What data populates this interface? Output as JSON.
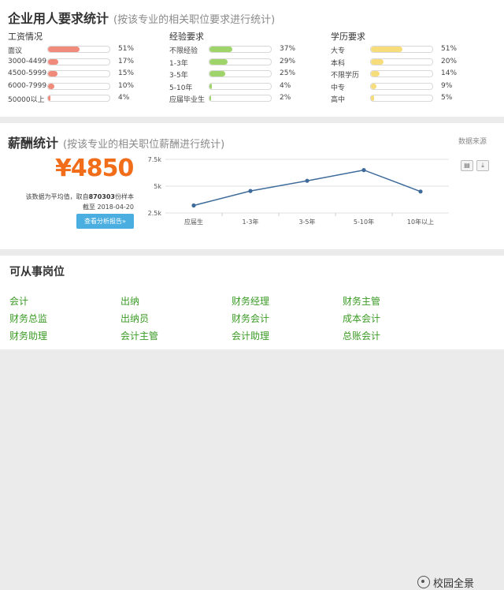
{
  "requirements": {
    "title": "企业用人要求统计",
    "subtitle": "(按该专业的相关职位要求进行统计)",
    "columns": [
      {
        "heading": "工资情况",
        "color": "#f08a7a",
        "rows": [
          {
            "label": "面议",
            "pct": "51%",
            "value": 51
          },
          {
            "label": "3000-4499",
            "pct": "17%",
            "value": 17
          },
          {
            "label": "4500-5999",
            "pct": "15%",
            "value": 15
          },
          {
            "label": "6000-7999",
            "pct": "10%",
            "value": 10
          },
          {
            "label": "50000以上",
            "pct": "4%",
            "value": 4
          }
        ]
      },
      {
        "heading": "经验要求",
        "color": "#9fd46a",
        "rows": [
          {
            "label": "不限经验",
            "pct": "37%",
            "value": 37
          },
          {
            "label": "1-3年",
            "pct": "29%",
            "value": 29
          },
          {
            "label": "3-5年",
            "pct": "25%",
            "value": 25
          },
          {
            "label": "5-10年",
            "pct": "4%",
            "value": 4
          },
          {
            "label": "应届毕业生",
            "pct": "2%",
            "value": 2
          }
        ]
      },
      {
        "heading": "学历要求",
        "color": "#f6dc7a",
        "rows": [
          {
            "label": "大专",
            "pct": "51%",
            "value": 51
          },
          {
            "label": "本科",
            "pct": "20%",
            "value": 20
          },
          {
            "label": "不限学历",
            "pct": "14%",
            "value": 14
          },
          {
            "label": "中专",
            "pct": "9%",
            "value": 9
          },
          {
            "label": "高中",
            "pct": "5%",
            "value": 5
          }
        ]
      }
    ]
  },
  "salary": {
    "title": "薪酬统计",
    "subtitle": "(按该专业的相关职位薪酬进行统计)",
    "source_link": "数据来源",
    "amount": "¥4850",
    "note_pre": "该数据为平均值，取自",
    "note_count": "870303",
    "note_post": "份样本",
    "note_date": "截至 2018-04-20",
    "button": "查看分析报告»",
    "icons": [
      "print-icon",
      "download-icon"
    ]
  },
  "chart_data": {
    "type": "line",
    "categories": [
      "应届生",
      "1-3年",
      "3-5年",
      "5-10年",
      "10年以上"
    ],
    "values": [
      3200,
      4550,
      5500,
      6500,
      4500
    ],
    "y_ticks": [
      "7.5k",
      "5k",
      "2.5k"
    ],
    "y_tick_values": [
      7500,
      5000,
      2500
    ],
    "ylim": [
      2500,
      7500
    ],
    "grid": "horizontal",
    "line_color": "#3f6b9a"
  },
  "jobs": {
    "title": "可从事岗位",
    "items": [
      "会计",
      "出纳",
      "财务经理",
      "财务主管",
      "财务总监",
      "出纳员",
      "财务会计",
      "成本会计",
      "财务助理",
      "会计主管",
      "会计助理",
      "总账会计"
    ]
  },
  "watermark": {
    "text": "校园全景",
    "icon": "wechat-icon"
  }
}
